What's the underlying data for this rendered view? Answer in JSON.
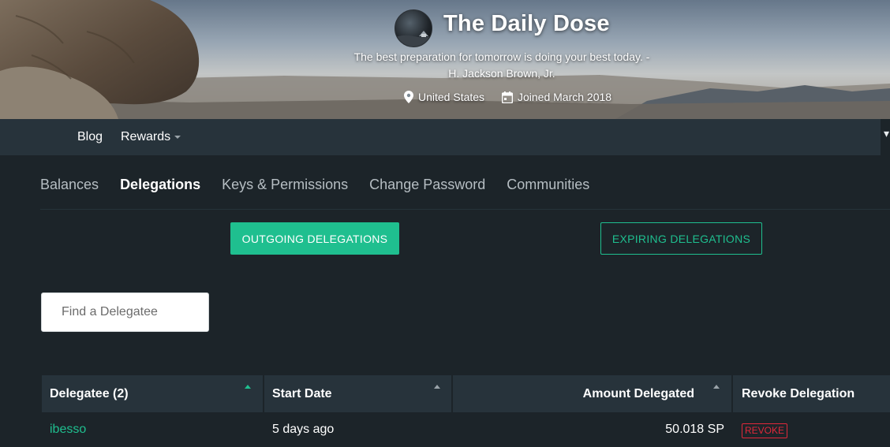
{
  "profile": {
    "name": "The Daily Dose",
    "about_line1": "The best preparation for tomorrow is doing your best today. -",
    "about_line2": "H. Jackson Brown, Jr.",
    "location": "United States",
    "joined": "Joined March 2018"
  },
  "topnav": {
    "blog": "Blog",
    "rewards": "Rewards"
  },
  "subtabs": [
    "Balances",
    "Delegations",
    "Keys & Permissions",
    "Change Password",
    "Communities"
  ],
  "active_subtab": "Delegations",
  "buttons": {
    "outgoing": "OUTGOING DELEGATIONS",
    "expiring": "EXPIRING DELEGATIONS"
  },
  "search": {
    "placeholder": "Find a Delegatee",
    "value": ""
  },
  "table": {
    "headers": [
      "Delegatee (2)",
      "Start Date",
      "Amount Delegated",
      "Revoke Delegation"
    ],
    "rows": [
      {
        "delegatee": "ibesso",
        "start": "5 days ago",
        "amount": "50.018 SP",
        "action": "REVOKE"
      }
    ]
  },
  "colors": {
    "accent": "#1fbf8f",
    "danger": "#e0283a",
    "background": "#1c2429",
    "header": "#27333b"
  }
}
